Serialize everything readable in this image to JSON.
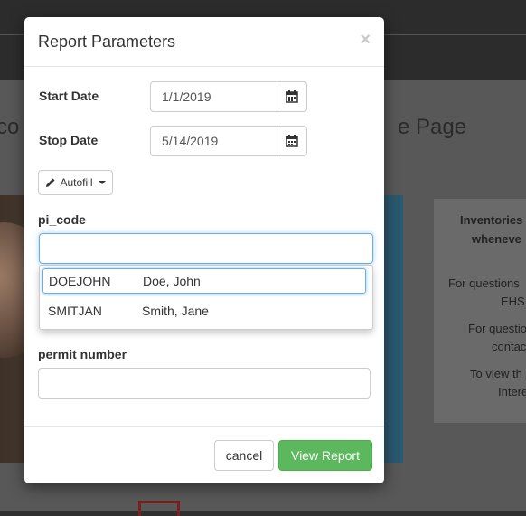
{
  "background": {
    "heading_left": "co",
    "heading_right": "e Page",
    "card_lines": [
      "Inventories",
      "wheneve",
      "For questions",
      "EHS",
      "For questio",
      "contac",
      "To view th",
      "Intere"
    ]
  },
  "modal": {
    "title": "Report Parameters",
    "close_glyph": "×",
    "start_date": {
      "label": "Start Date",
      "value": "1/1/2019"
    },
    "stop_date": {
      "label": "Stop Date",
      "value": "5/14/2019"
    },
    "autofill_label": "Autofill",
    "pi_code": {
      "label": "pi_code",
      "value": "",
      "suggestions": [
        {
          "code": "DOEJOHN",
          "name": "Doe, John",
          "active": true
        },
        {
          "code": "SMITJAN",
          "name": "Smith, Jane",
          "active": false
        }
      ]
    },
    "permit": {
      "label": "permit number",
      "value": ""
    },
    "buttons": {
      "cancel": "cancel",
      "view_report": "View Report"
    },
    "colors": {
      "primary_action": "#5cb85c",
      "focus_border": "#66afe9"
    }
  },
  "icons": {
    "calendar": "calendar-icon",
    "pencil": "pencil-icon",
    "caret": "caret-down-icon"
  }
}
